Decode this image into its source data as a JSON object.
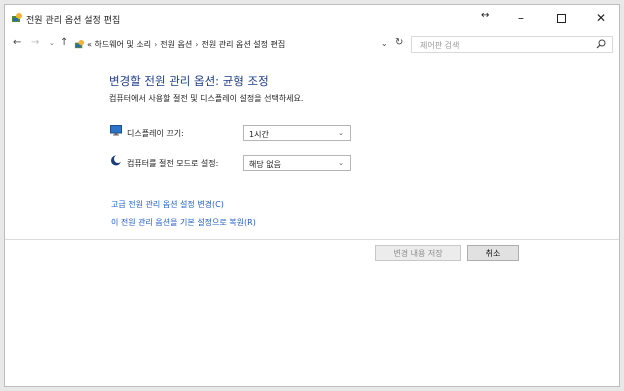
{
  "window": {
    "title": "전원 관리 옵션 설정 편집",
    "resize_glyph": "↔",
    "minimize_glyph": "–",
    "close_glyph": "✕"
  },
  "address": {
    "back_glyph": "←",
    "forward_glyph": "→",
    "recent_glyph": "⌄",
    "up_glyph": "↑",
    "overflow": "«",
    "crumbs": [
      "하드웨어 및 소리",
      "전원 옵션",
      "전원 관리 옵션 설정 편집"
    ],
    "separator": "›",
    "dropdown_glyph": "⌄",
    "refresh_glyph": "↻",
    "search_placeholder": "제어판 검색"
  },
  "main": {
    "heading": "변경할 전원 관리 옵션: 균형 조정",
    "subtext": "컴퓨터에서 사용할 절전 및 디스플레이 설정을 선택하세요.",
    "settings": [
      {
        "label": "디스플레이 끄기:",
        "value": "1시간",
        "icon": "monitor-icon"
      },
      {
        "label": "컴퓨터를 절전 모드로 설정:",
        "value": "해당 없음",
        "icon": "moon-icon"
      }
    ],
    "combo_arrow": "⌄",
    "links": {
      "advanced": "고급 전원 관리 옵션 설정 변경(C)",
      "restore": "이 전원 관리 옵션을 기본 설정으로 복원(R)"
    }
  },
  "footer": {
    "save_label": "변경 내용 저장",
    "cancel_label": "취소"
  },
  "colors": {
    "heading": "#1f3d8a",
    "link": "#1e5ec8",
    "disabled_text": "#8c8c8c"
  }
}
